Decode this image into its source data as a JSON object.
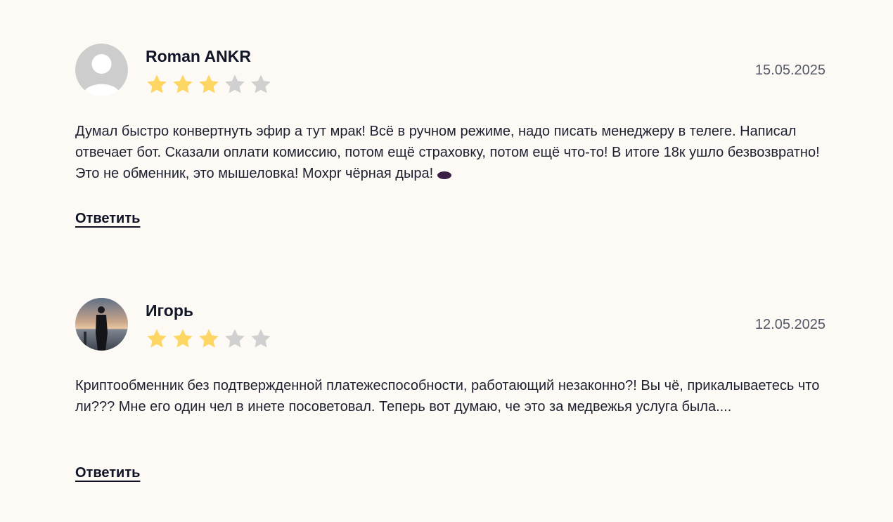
{
  "reviews": [
    {
      "author": "Roman ANKR",
      "date": "15.05.2025",
      "rating": 3,
      "max_rating": 5,
      "avatar": "default-user-avatar",
      "text": "Думал быстро конвертнуть эфир а тут мрак! Всё в ручном режиме, надо писать менеджеру в телеге. Написал отвечает бот. Сказали оплати комиссию, потом ещё страховку, потом ещё что-то! В итоге 18к ушло безвозвратно! Это не обменник, это мышеловка! Moxpr чёрная дыра!",
      "emoji": "hole-emoji",
      "reply_label": "Ответить"
    },
    {
      "author": "Игорь",
      "date": "12.05.2025",
      "rating": 3,
      "max_rating": 5,
      "avatar": "photo-avatar",
      "text": "Криптообменник без подтвержденной платежеспособности, работающий незаконно?! Вы чё, прикалываетесь что ли??? Мне его один чел в инете посоветовал. Теперь вот думаю, че это за медвежья услуга была....",
      "reply_label": "Ответить"
    }
  ],
  "colors": {
    "background": "#fdfaf6",
    "star_filled": "#fdd663",
    "star_empty": "#d0d0d0",
    "text": "#1e2030"
  }
}
